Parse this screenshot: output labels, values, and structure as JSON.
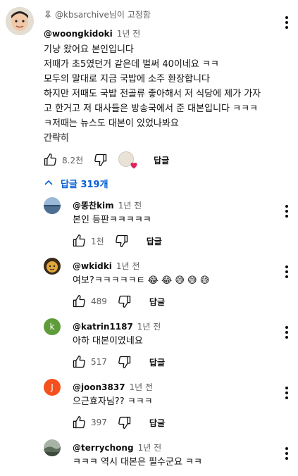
{
  "pinned_comment": {
    "pinned_label": "@kbsarchive님이 고정함",
    "author": "@woongkidoki",
    "time": "1년 전",
    "lines": [
      "기냥 왔어요 본인입니다",
      "저때가 초5였던거 같은데 벌써 40이네요 ㅋㅋ",
      "모두의 말대로 지금 국밥에 소주 환장합니다",
      "하지만 저때도 국밥 전골류 좋아해서 저 식당에 제가 가자",
      "고 한거고 저 대사들은 방송국에서 준 대본입니다 ㅋㅋㅋ",
      "ㅋ저때는 뉴스도 대본이 있었나봐요"
    ],
    "read_less": "간략히",
    "likes": "8.2천",
    "reply_label": "답글"
  },
  "replies_toggle": {
    "label": "답글 319개"
  },
  "replies": [
    {
      "author": "@똥찬kim",
      "time": "1년 전",
      "text": "본인 등판ㅋㅋㅋㅋㅋ",
      "likes": "1천",
      "reply_label": "답글",
      "avatar_color": "#6b8fb5",
      "avatar_letter": ""
    },
    {
      "author": "@wkidki",
      "time": "1년 전",
      "text": "여보?ㅋㅋㅋㅋㅋㅌ 😂 😂 😅 😅 😅",
      "likes": "489",
      "reply_label": "답글",
      "avatar_color": "#c8952f",
      "avatar_letter": ""
    },
    {
      "author": "@katrin1187",
      "time": "1년 전",
      "text": "아하 대본이였네요",
      "likes": "517",
      "reply_label": "답글",
      "avatar_color": "#5e9c3a",
      "avatar_letter": "k"
    },
    {
      "author": "@joon3837",
      "time": "1년 전",
      "text": "으근효자님?? ㅋㅋㅋ",
      "likes": "397",
      "reply_label": "답글",
      "avatar_color": "#f4511e",
      "avatar_letter": "J"
    },
    {
      "author": "@terrychong",
      "time": "1년 전",
      "text": "ㅋㅋㅋ 역시 대본은 필수군요 ㅋㅋ",
      "likes": "",
      "reply_label": "",
      "avatar_color": "#7f8a7d",
      "avatar_letter": ""
    }
  ]
}
